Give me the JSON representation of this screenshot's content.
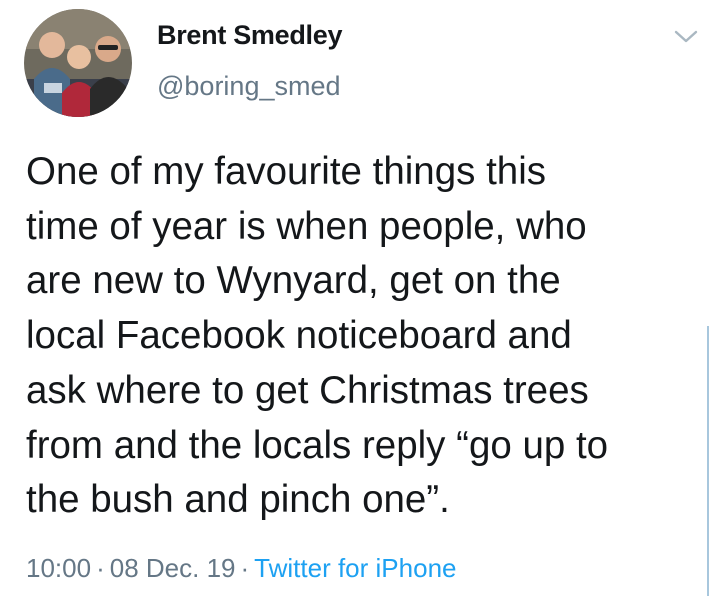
{
  "author": {
    "display_name": "Brent Smedley",
    "handle": "@boring_smed"
  },
  "tweet": {
    "lines": [
      "One of my favourite things this",
      "time of year is when people, who",
      "are new to Wynyard, get on the",
      "local Facebook noticeboard and",
      "ask where to get Christmas trees",
      "from and the locals reply “go up to",
      "the bush and pinch one”."
    ]
  },
  "meta": {
    "time": "10:00",
    "date": "08 Dec. 19",
    "separator": "·",
    "source": "Twitter for iPhone"
  },
  "icons": {
    "caret": "chevron-down-icon"
  },
  "colors": {
    "text": "#14171a",
    "secondary": "#657786",
    "link": "#1da1f2"
  }
}
